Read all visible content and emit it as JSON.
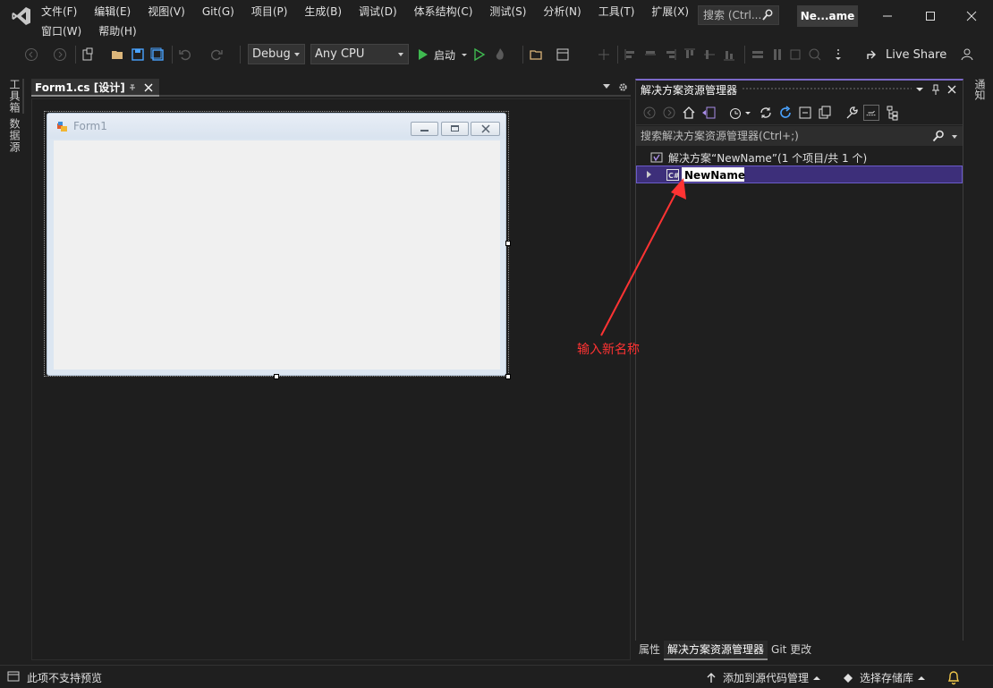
{
  "menu": {
    "row1": [
      "文件(F)",
      "编辑(E)",
      "视图(V)",
      "Git(G)",
      "项目(P)",
      "生成(B)",
      "调试(D)",
      "体系结构(C)",
      "测试(S)",
      "分析(N)",
      "工具(T)",
      "扩展(X)"
    ],
    "row2": [
      "窗口(W)",
      "帮助(H)"
    ]
  },
  "search": {
    "placeholder": "搜索 (Ctrl..."
  },
  "solution_badge": "Ne...ame",
  "toolbar": {
    "config": "Debug",
    "platform": "Any CPU",
    "start_label": "启动",
    "live_share": "Live Share"
  },
  "left_strip": {
    "toolbox": "工具箱",
    "datasources": "数据源"
  },
  "doc_tab": {
    "label": "Form1.cs [设计]"
  },
  "form": {
    "title": "Form1"
  },
  "solution_explorer": {
    "title": "解决方案资源管理器",
    "search_placeholder": "搜索解决方案资源管理器(Ctrl+;)",
    "solution_node": "解决方案“NewName”(1 个项目/共 1 个)",
    "project_name_input": "NewName",
    "bottom_tabs": [
      "属性",
      "解决方案资源管理器",
      "Git 更改"
    ]
  },
  "right_strip": {
    "notifications": "通知"
  },
  "annotation": {
    "text": "输入新名称",
    "color": "#ff3333"
  },
  "statusbar": {
    "text": "此项不支持预览",
    "add_source_control": "添加到源代码管理",
    "select_repo": "选择存储库"
  },
  "colors": {
    "accent": "#7b68c8",
    "selection": "#3d2f7a"
  }
}
